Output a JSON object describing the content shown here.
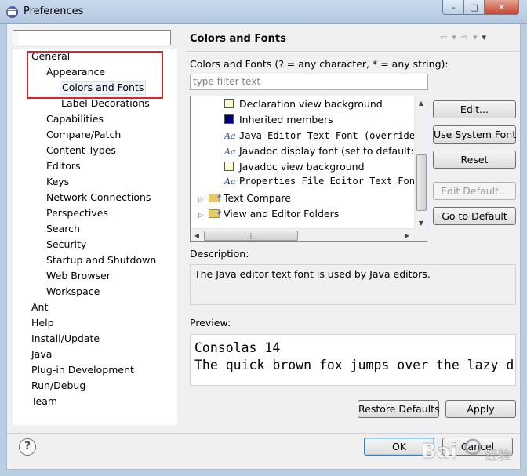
{
  "window": {
    "title": "Preferences",
    "min_glyph": "–",
    "max_glyph": "□",
    "close_glyph": "✕"
  },
  "left": {
    "filter_value": "",
    "tree": [
      {
        "label": "General",
        "level": 0
      },
      {
        "label": "Appearance",
        "level": 1
      },
      {
        "label": "Colors and Fonts",
        "level": 2,
        "selected": true
      },
      {
        "label": "Label Decorations",
        "level": 2
      },
      {
        "label": "Capabilities",
        "level": 1
      },
      {
        "label": "Compare/Patch",
        "level": 1
      },
      {
        "label": "Content Types",
        "level": 1
      },
      {
        "label": "Editors",
        "level": 1
      },
      {
        "label": "Keys",
        "level": 1
      },
      {
        "label": "Network Connections",
        "level": 1
      },
      {
        "label": "Perspectives",
        "level": 1
      },
      {
        "label": "Search",
        "level": 1
      },
      {
        "label": "Security",
        "level": 1
      },
      {
        "label": "Startup and Shutdown",
        "level": 1
      },
      {
        "label": "Web Browser",
        "level": 1
      },
      {
        "label": "Workspace",
        "level": 1
      },
      {
        "label": "Ant",
        "level": 0
      },
      {
        "label": "Help",
        "level": 0
      },
      {
        "label": "Install/Update",
        "level": 0
      },
      {
        "label": "Java",
        "level": 0
      },
      {
        "label": "Plug-in Development",
        "level": 0
      },
      {
        "label": "Run/Debug",
        "level": 0
      },
      {
        "label": "Team",
        "level": 0
      }
    ]
  },
  "page": {
    "title": "Colors and Fonts",
    "nav": {
      "back": "⇦",
      "back_menu": "▾",
      "forward": "⇨",
      "forward_menu": "▾",
      "view_menu": "▾"
    },
    "filter_label": "Colors and Fonts (? = any character, * = any string):",
    "filter_placeholder": "type filter text",
    "items": [
      {
        "kind": "color",
        "color": "#fffbd0",
        "label": "Declaration view background",
        "mono": false
      },
      {
        "kind": "color",
        "color": "#000080",
        "label": "Inherited members",
        "mono": false
      },
      {
        "kind": "font",
        "icon": "Aa",
        "label": "Java Editor Text Font (overrides",
        "mono": true
      },
      {
        "kind": "font",
        "icon": "Aa",
        "label": "Javadoc display font (set to default: D",
        "mono": false
      },
      {
        "kind": "color",
        "color": "#fffbd0",
        "label": "Javadoc view background",
        "mono": false
      },
      {
        "kind": "font",
        "icon": "Aa",
        "label": "Properties File Editor Text Font",
        "mono": true
      },
      {
        "kind": "folder",
        "label": "Text Compare"
      },
      {
        "kind": "folder",
        "label": "View and Editor Folders"
      }
    ],
    "buttons": {
      "edit": "Edit...",
      "use_system_font": "Use System Font",
      "reset": "Reset",
      "edit_default": "Edit Default...",
      "go_to_default": "Go to Default"
    },
    "description_label": "Description:",
    "description": "The Java editor text font is used by Java editors.",
    "preview_label": "Preview:",
    "preview_line1": "Consolas 14",
    "preview_line2": "The quick brown fox jumps over the lazy d",
    "restore_defaults": "Restore Defaults",
    "apply": "Apply"
  },
  "footer": {
    "help": "?",
    "ok": "OK",
    "cancel": "Cancel"
  },
  "watermark": {
    "text": "Bai",
    "suffix": "经验"
  }
}
